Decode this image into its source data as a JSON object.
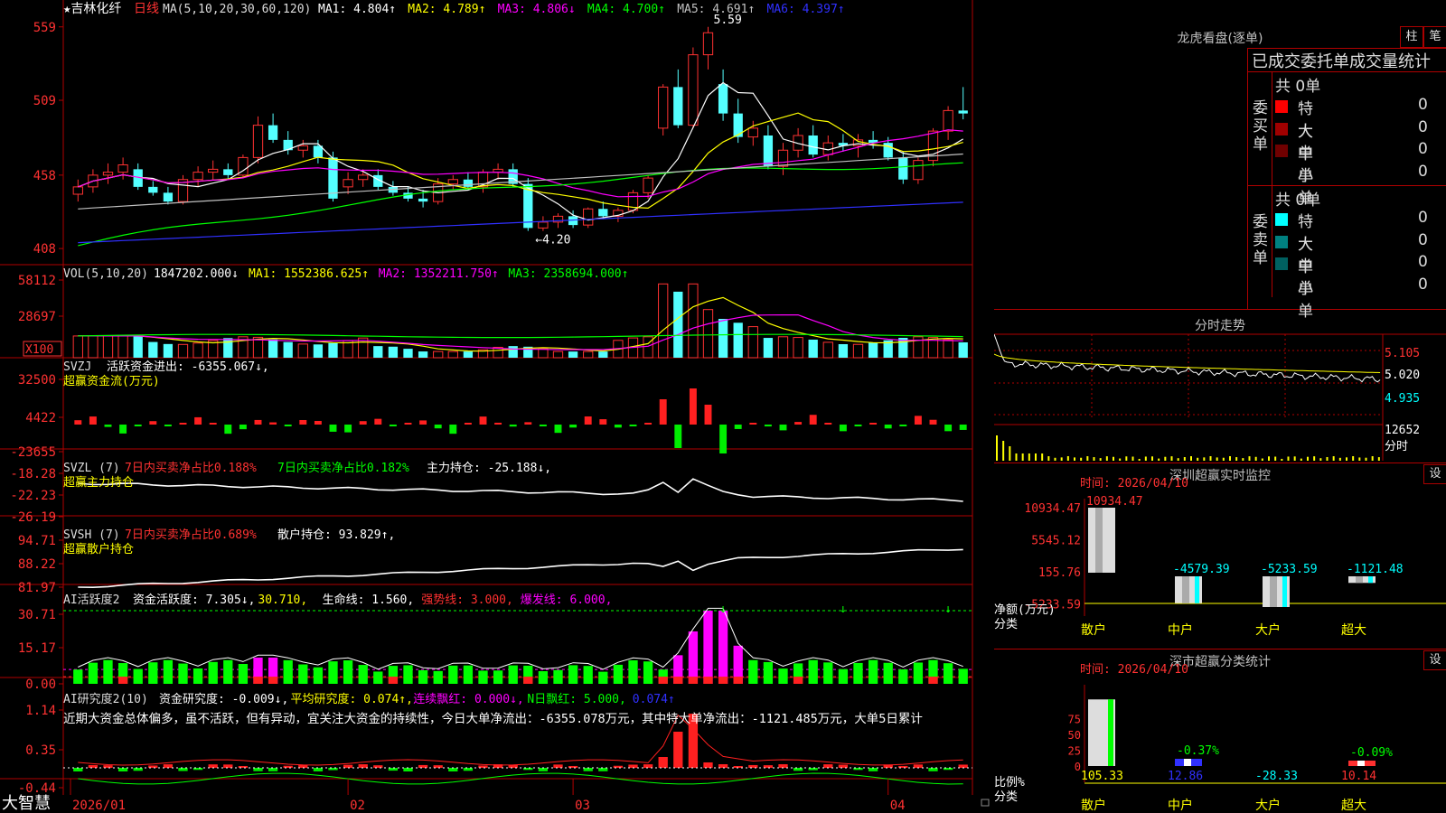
{
  "stock": {
    "star": "★",
    "name": "吉林化纤",
    "period": "日线"
  },
  "brand": "大智慧",
  "panels": {
    "price": {
      "ma_header": "MA(5,10,20,30,60,120)",
      "ma": [
        {
          "label": "MA1: 4.804↑",
          "color": "#ffffff"
        },
        {
          "label": "MA2: 4.789↑",
          "color": "#ffff00"
        },
        {
          "label": "MA3: 4.806↓",
          "color": "#ff00ff"
        },
        {
          "label": "MA4: 4.700↑",
          "color": "#00ff00"
        },
        {
          "label": "MA5: 4.691↑",
          "color": "#c0c0c0"
        },
        {
          "label": "MA6: 4.397↑",
          "color": "#3030ff"
        }
      ],
      "yticks": [
        "559",
        "509",
        "458",
        "408"
      ],
      "high_label": "5.59",
      "low_label": "←4.20"
    },
    "vol": {
      "header": "VOL(5,10,20)",
      "value": "1847202.000↓",
      "ma": [
        {
          "label": "MA1: 1552386.625↑",
          "color": "#ffff00"
        },
        {
          "label": "MA2: 1352211.750↑",
          "color": "#ff00ff"
        },
        {
          "label": "MA3: 2358694.000↑",
          "color": "#00ff00"
        }
      ],
      "yticks": [
        "58112",
        "28697"
      ],
      "unit": "X100"
    },
    "svzj": {
      "header": "SVZJ",
      "item": "活跃资金进出: -6355.067↓,",
      "subtitle": "超赢资金流(万元)",
      "yticks": [
        "32500",
        "4422",
        "-23655"
      ]
    },
    "svzl": {
      "header": "SVZL (7)",
      "item1": "7日内买卖净占比0.188%",
      "item2": "7日内买卖净占比0.182%",
      "item3": "主力持仓: -25.188↓,",
      "subtitle": "超赢主力持仓",
      "yticks": [
        "-18.28",
        "-22.23",
        "-26.19"
      ]
    },
    "svsh": {
      "header": "SVSH (7)",
      "item1": "7日内买卖净占比0.689%",
      "item2": "散户持仓: 93.829↑,",
      "subtitle": "超赢散户持仓",
      "yticks": [
        "94.71",
        "88.22",
        "81.97"
      ]
    },
    "ai1": {
      "header": "AI活跃度2",
      "items": [
        {
          "label": "资金活跃度: 7.305↓,",
          "color": "#ffffff"
        },
        {
          "label": "30.710,",
          "color": "#ffff00"
        },
        {
          "label": "生命线: 1.560,",
          "color": "#ffffff"
        },
        {
          "label": "强势线: 3.000,",
          "color": "#ff3030"
        },
        {
          "label": "爆发线: 6.000,",
          "color": "#ff00ff"
        }
      ],
      "yticks": [
        "30.71",
        "15.17",
        "0.00"
      ]
    },
    "ai2": {
      "header": "AI研究度2(10)",
      "items": [
        {
          "label": "资金研究度: -0.009↓,",
          "color": "#ffffff"
        },
        {
          "label": "平均研究度: 0.074↑,",
          "color": "#ffff00"
        },
        {
          "label": "连续飘红: 0.000↓,",
          "color": "#ff00ff"
        },
        {
          "label": "N日飘红: 5.000,",
          "color": "#00ff00"
        },
        {
          "label": "0.074↑",
          "color": "#3030ff"
        }
      ],
      "comment": "近期大资金总体偏多，虽不活跃，但有异动，宜关注大资金的持续性，今日大单净流出：-6355.078万元，其中特大单净流出：-1121.485万元，大单5日累计",
      "yticks": [
        "1.14",
        "0.35",
        "-0.44"
      ]
    }
  },
  "xaxis": [
    "2026/01",
    "02",
    "03",
    "04"
  ],
  "right": {
    "lhb": {
      "title": "龙虎看盘(逐单)",
      "tab1": "柱",
      "tab2": "笔",
      "header": "已成交委托单成交量统计",
      "buy": {
        "side": "委买单",
        "count": "共 0单",
        "rows": [
          {
            "label": "特大",
            "val": "0",
            "pct": "0%",
            "color": "#ff0000"
          },
          {
            "label": "大单",
            "val": "0",
            "pct": "0%",
            "color": "#a00000"
          },
          {
            "label": "中单",
            "val": "0",
            "pct": "0%",
            "color": "#700000"
          },
          {
            "label": "小单",
            "val": "0",
            "pct": "0%",
            "color": ""
          }
        ]
      },
      "sell": {
        "side": "委卖单",
        "count": "共 0单",
        "rows": [
          {
            "label": "特大",
            "val": "0",
            "pct": "0%",
            "color": "#00ffff"
          },
          {
            "label": "大单",
            "val": "0",
            "pct": "0%",
            "color": "#008080"
          },
          {
            "label": "中单",
            "val": "0",
            "pct": "0%",
            "color": "#006060"
          },
          {
            "label": "小单",
            "val": "0",
            "pct": "0%",
            "color": ""
          }
        ]
      }
    },
    "fenshi": {
      "title": "分时走势",
      "yticks": [
        "5.105",
        "5.020",
        "4.935"
      ],
      "vol_label": "12652",
      "time_label": "分时"
    },
    "sz_monitor": {
      "title": "深圳超赢实时监控",
      "btn": "设",
      "time": "时间: 2026/04/10",
      "yticks": [
        "10934.47",
        "5545.12",
        "155.76",
        "-5233.59"
      ],
      "ylabel1": "净额(万元)",
      "ylabel2": "分类",
      "cats": [
        "散户",
        "中户",
        "大户",
        "超大"
      ],
      "values": [
        10934.47,
        -4579.39,
        -5233.59,
        -1121.48
      ],
      "value_labels": [
        "10934.47",
        "-4579.39",
        "-5233.59",
        "-1121.48"
      ]
    },
    "sz_class": {
      "title": "深市超赢分类统计",
      "btn": "设",
      "time": "时间: 2026/04/10",
      "yticks": [
        "75",
        "50",
        "25",
        "0"
      ],
      "ylabel1": "比例%",
      "ylabel2": "分类",
      "cats": [
        "散户",
        "中户",
        "大户",
        "超大"
      ],
      "top_labels": [
        "",
        "-0.37%",
        "",
        "-0.09%"
      ],
      "bottom_labels": [
        "105.33",
        "12.86",
        "-28.33",
        "10.14"
      ],
      "values": [
        105.33,
        12.86,
        -28.33,
        10.14
      ]
    }
  },
  "chart_data": {
    "type": "candlestick",
    "title": "吉林化纤 日线",
    "x_ticks": [
      "2026/01",
      "02",
      "03",
      "04"
    ],
    "ohlc": [
      [
        4.45,
        4.55,
        4.4,
        4.5
      ],
      [
        4.5,
        4.62,
        4.46,
        4.58
      ],
      [
        4.58,
        4.66,
        4.52,
        4.6
      ],
      [
        4.6,
        4.7,
        4.55,
        4.65
      ],
      [
        4.62,
        4.66,
        4.48,
        4.5
      ],
      [
        4.5,
        4.54,
        4.44,
        4.46
      ],
      [
        4.46,
        4.5,
        4.38,
        4.4
      ],
      [
        4.4,
        4.58,
        4.38,
        4.55
      ],
      [
        4.55,
        4.64,
        4.5,
        4.6
      ],
      [
        4.6,
        4.68,
        4.55,
        4.62
      ],
      [
        4.62,
        4.66,
        4.55,
        4.58
      ],
      [
        4.58,
        4.72,
        4.56,
        4.7
      ],
      [
        4.7,
        4.98,
        4.66,
        4.92
      ],
      [
        4.92,
        5.0,
        4.8,
        4.82
      ],
      [
        4.82,
        4.88,
        4.72,
        4.75
      ],
      [
        4.75,
        4.82,
        4.7,
        4.78
      ],
      [
        4.78,
        4.82,
        4.66,
        4.7
      ],
      [
        4.7,
        4.74,
        4.4,
        4.42
      ],
      [
        4.5,
        4.6,
        4.45,
        4.55
      ],
      [
        4.55,
        4.62,
        4.5,
        4.58
      ],
      [
        4.58,
        4.62,
        4.48,
        4.5
      ],
      [
        4.5,
        4.54,
        4.44,
        4.46
      ],
      [
        4.46,
        4.5,
        4.4,
        4.42
      ],
      [
        4.42,
        4.48,
        4.36,
        4.4
      ],
      [
        4.4,
        4.56,
        4.38,
        4.52
      ],
      [
        4.52,
        4.58,
        4.48,
        4.55
      ],
      [
        4.55,
        4.6,
        4.48,
        4.5
      ],
      [
        4.5,
        4.62,
        4.46,
        4.6
      ],
      [
        4.6,
        4.66,
        4.55,
        4.62
      ],
      [
        4.62,
        4.66,
        4.5,
        4.52
      ],
      [
        4.52,
        4.56,
        4.2,
        4.22
      ],
      [
        4.22,
        4.3,
        4.2,
        4.26
      ],
      [
        4.26,
        4.32,
        4.22,
        4.3
      ],
      [
        4.3,
        4.34,
        4.22,
        4.24
      ],
      [
        4.24,
        4.36,
        4.22,
        4.35
      ],
      [
        4.35,
        4.4,
        4.28,
        4.3
      ],
      [
        4.3,
        4.36,
        4.26,
        4.34
      ],
      [
        4.34,
        4.48,
        4.32,
        4.46
      ],
      [
        4.46,
        4.58,
        4.42,
        4.56
      ],
      [
        4.9,
        5.2,
        4.85,
        5.18
      ],
      [
        5.18,
        5.3,
        4.9,
        4.92
      ],
      [
        4.92,
        5.45,
        4.9,
        5.4
      ],
      [
        5.4,
        5.59,
        5.3,
        5.55
      ],
      [
        5.2,
        5.3,
        4.95,
        5.0
      ],
      [
        5.0,
        5.1,
        4.8,
        4.84
      ],
      [
        4.84,
        4.95,
        4.78,
        4.9
      ],
      [
        4.85,
        4.92,
        4.62,
        4.64
      ],
      [
        4.64,
        4.8,
        4.58,
        4.75
      ],
      [
        4.75,
        4.9,
        4.7,
        4.85
      ],
      [
        4.85,
        4.92,
        4.7,
        4.72
      ],
      [
        4.72,
        4.85,
        4.68,
        4.8
      ],
      [
        4.8,
        4.86,
        4.74,
        4.78
      ],
      [
        4.78,
        4.86,
        4.7,
        4.82
      ],
      [
        4.82,
        4.88,
        4.76,
        4.8
      ],
      [
        4.8,
        4.84,
        4.68,
        4.7
      ],
      [
        4.7,
        4.74,
        4.52,
        4.55
      ],
      [
        4.55,
        4.7,
        4.52,
        4.68
      ],
      [
        4.68,
        4.9,
        4.64,
        4.88
      ],
      [
        4.88,
        5.05,
        4.82,
        5.02
      ],
      [
        5.02,
        5.18,
        4.96,
        5.0
      ]
    ]
  }
}
